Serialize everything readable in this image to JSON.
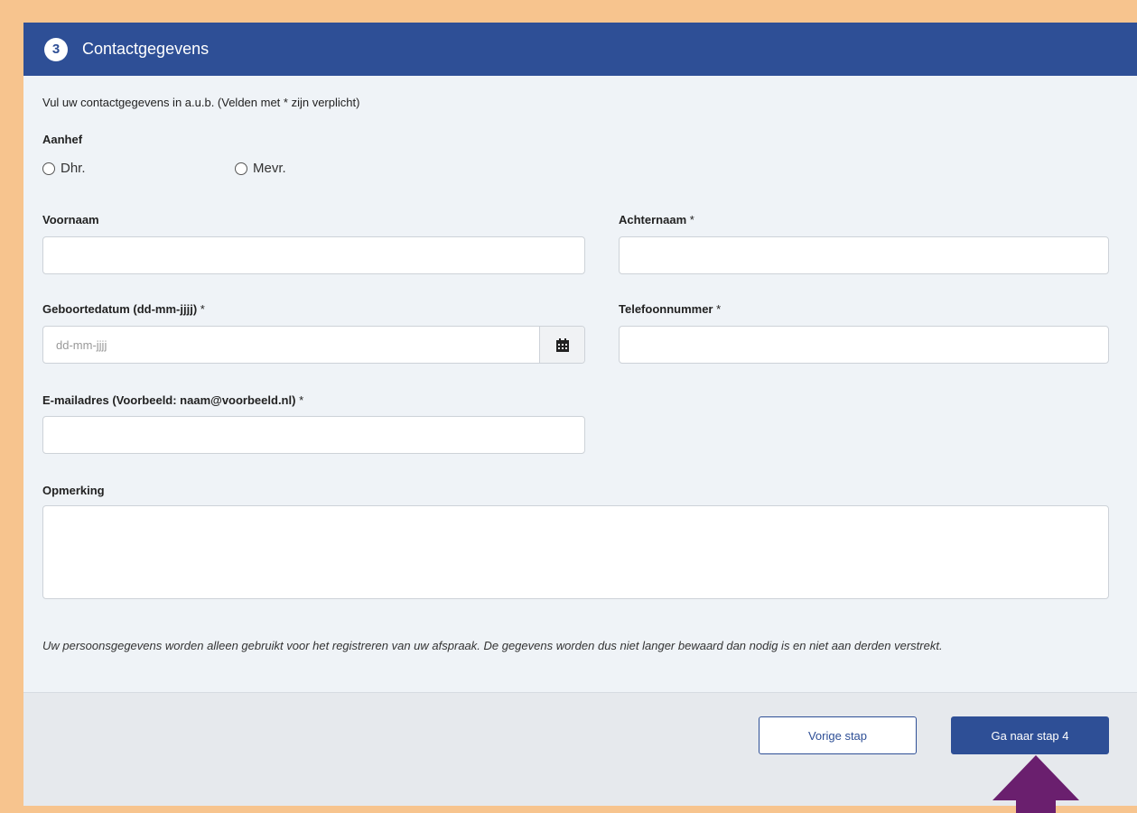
{
  "header": {
    "step_number": "3",
    "title": "Contactgegevens"
  },
  "intro": "Vul uw contactgegevens in a.u.b. (Velden met * zijn verplicht)",
  "salutation": {
    "label": "Aanhef",
    "options": [
      "Dhr.",
      "Mevr."
    ]
  },
  "fields": {
    "first_name": {
      "label": "Voornaam",
      "value": ""
    },
    "last_name": {
      "label": "Achternaam",
      "required": "*",
      "value": ""
    },
    "birthdate": {
      "label": "Geboortedatum (dd-mm-jjjj)",
      "required": "*",
      "placeholder": "dd-mm-jjjj",
      "value": "",
      "icon": "calendar-icon"
    },
    "phone": {
      "label": "Telefoonnummer",
      "required": "*",
      "value": ""
    },
    "email": {
      "label": "E-mailadres (Voorbeeld: naam@voorbeeld.nl)",
      "required": "*",
      "value": ""
    },
    "remark": {
      "label": "Opmerking",
      "value": ""
    }
  },
  "privacy_notice": "Uw persoonsgegevens worden alleen gebruikt voor het registreren van uw afspraak. De gegevens worden dus niet langer bewaard dan nodig is en niet aan derden verstrekt.",
  "buttons": {
    "previous": "Vorige stap",
    "next": "Ga naar stap 4"
  },
  "colors": {
    "primary": "#2e4f96",
    "page_background": "#f7c48e",
    "panel": "#eff3f7",
    "arrow": "#6a1f6e"
  }
}
